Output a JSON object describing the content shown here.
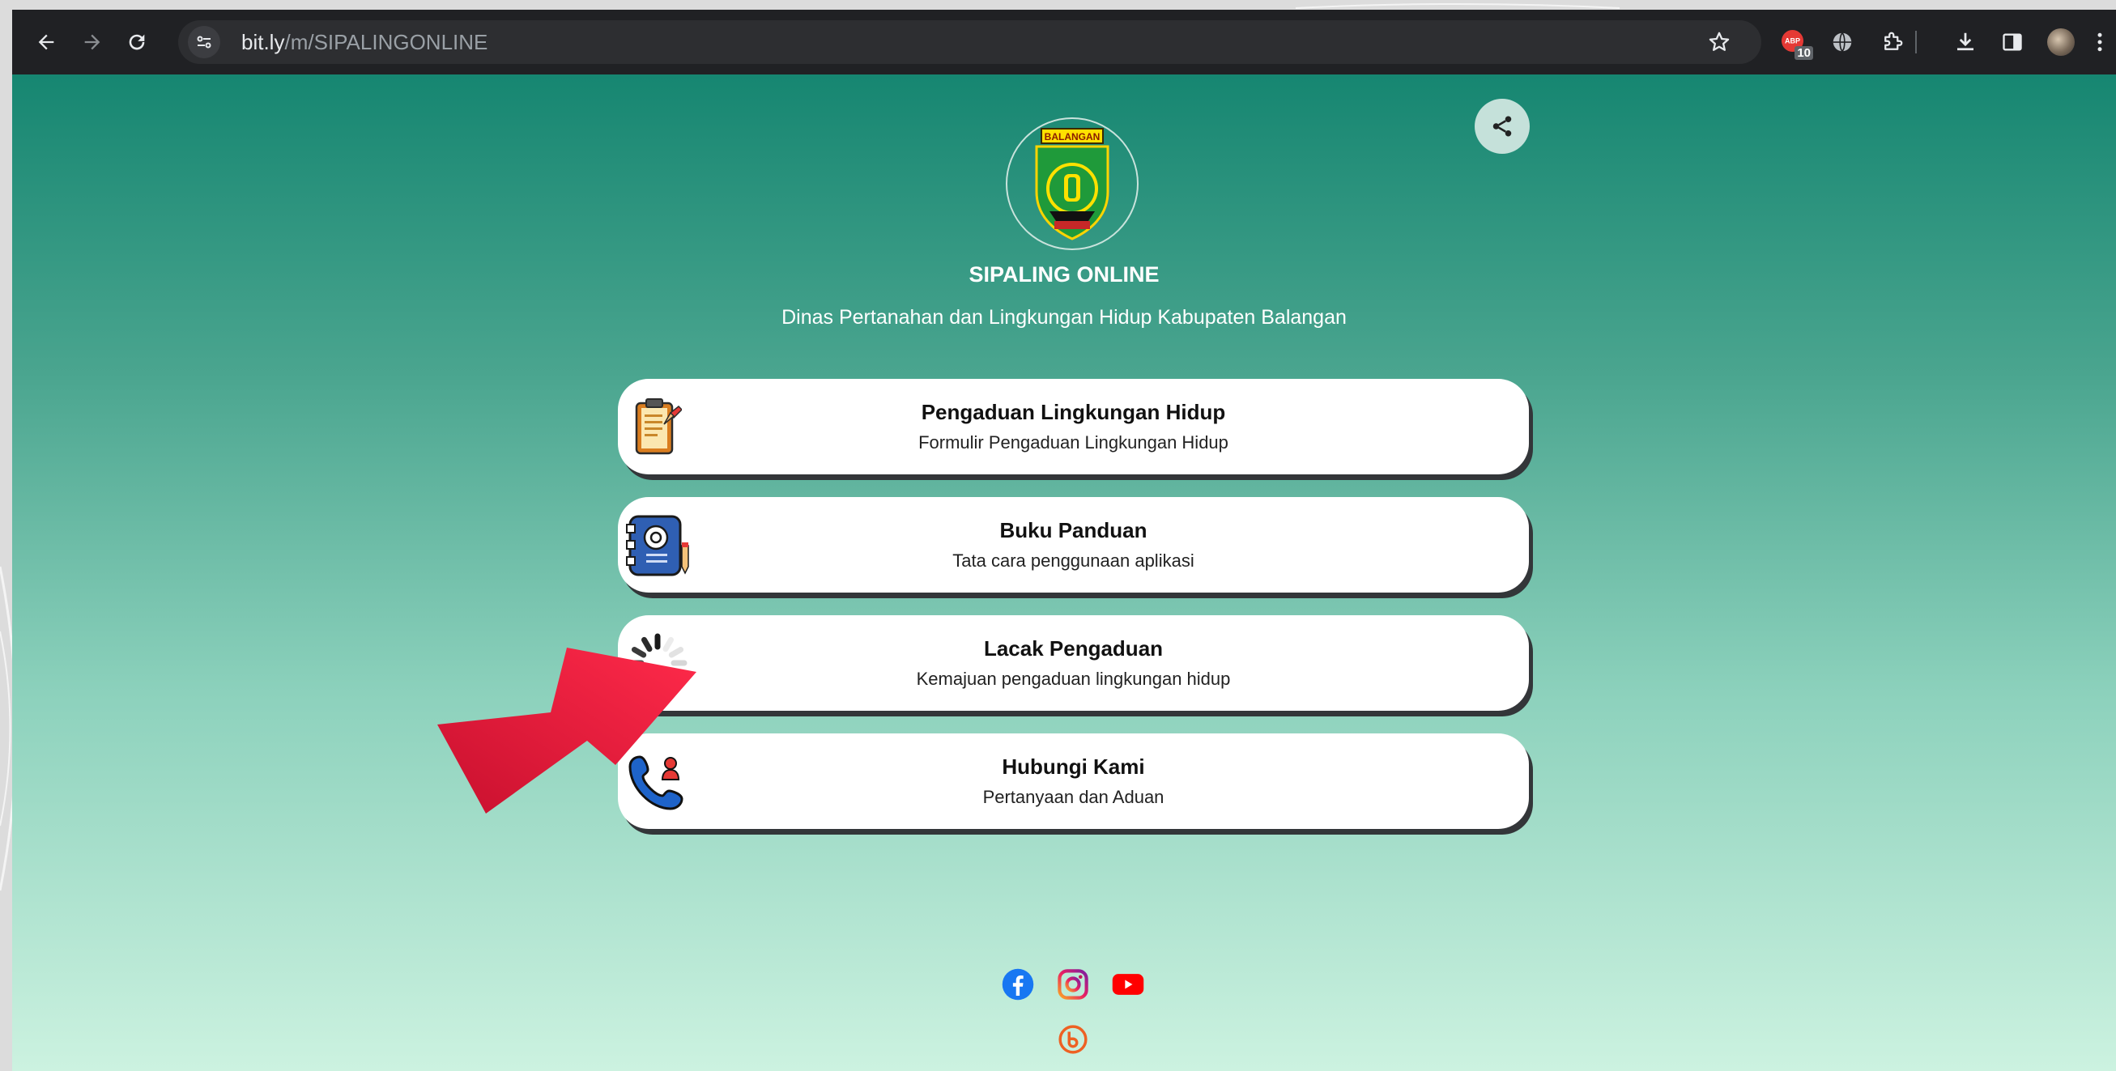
{
  "browser": {
    "url_host": "bit.ly",
    "url_path": "/m/SIPALINGONLINE",
    "extension_badge": "10",
    "icons": [
      "back-icon",
      "forward-icon",
      "reload-icon",
      "site-info-icon",
      "star-icon",
      "extension-icon",
      "globe-icon",
      "puzzle-icon",
      "download-icon",
      "side-panel-icon",
      "avatar",
      "more-icon"
    ]
  },
  "page": {
    "title": "SIPALING ONLINE",
    "subtitle": "Dinas Pertanahan dan Lingkungan Hidup Kabupaten Balangan",
    "logo_text": "BALANGAN",
    "links": [
      {
        "title": "Pengaduan Lingkungan Hidup",
        "desc": "Formulir Pengaduan Lingkungan Hidup",
        "icon": "clipboard-icon"
      },
      {
        "title": "Buku Panduan",
        "desc": "Tata cara penggunaan aplikasi",
        "icon": "manual-book-icon"
      },
      {
        "title": "Lacak Pengaduan",
        "desc": "Kemajuan pengaduan lingkungan hidup",
        "icon": "loading-spinner-icon"
      },
      {
        "title": "Hubungi Kami",
        "desc": "Pertanyaan dan Aduan",
        "icon": "phone-contact-icon"
      }
    ],
    "social": [
      "facebook-icon",
      "instagram-icon",
      "youtube-icon",
      "bitly-icon"
    ]
  },
  "colors": {
    "gradient_top": "#168671",
    "gradient_bottom": "#ccf2e0",
    "annotation_arrow": "#e0173a"
  }
}
